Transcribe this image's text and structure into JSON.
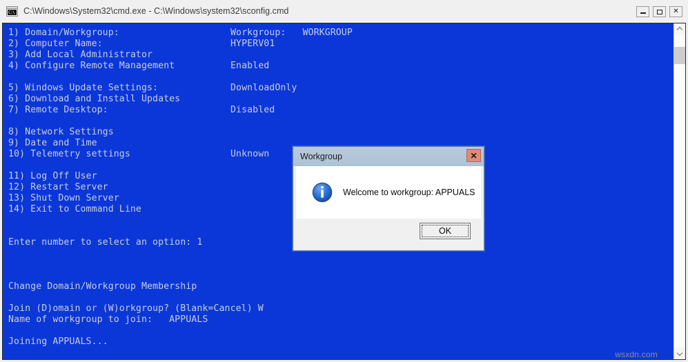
{
  "window": {
    "title": "C:\\Windows\\System32\\cmd.exe - C:\\Windows\\system32\\sconfig.cmd",
    "icon_text": "C:\\",
    "controls": {
      "minimize_label": "–",
      "maximize_label": "□",
      "close_label": "✕"
    }
  },
  "console": {
    "background_color": "#0b37d9",
    "text_color": "#c8cdd8",
    "lines": [
      {
        "label": "1) Domain/Workgroup:",
        "value": "Workgroup:   WORKGROUP"
      },
      {
        "label": "2) Computer Name:",
        "value": "HYPERV01"
      },
      {
        "label": "3) Add Local Administrator",
        "value": ""
      },
      {
        "label": "4) Configure Remote Management",
        "value": "Enabled"
      },
      {
        "label": "",
        "value": ""
      },
      {
        "label": "5) Windows Update Settings:",
        "value": "DownloadOnly"
      },
      {
        "label": "6) Download and Install Updates",
        "value": ""
      },
      {
        "label": "7) Remote Desktop:",
        "value": "Disabled"
      },
      {
        "label": "",
        "value": ""
      },
      {
        "label": "8) Network Settings",
        "value": ""
      },
      {
        "label": "9) Date and Time",
        "value": ""
      },
      {
        "label": "10) Telemetry settings",
        "value": "Unknown"
      },
      {
        "label": "",
        "value": ""
      },
      {
        "label": "11) Log Off User",
        "value": ""
      },
      {
        "label": "12) Restart Server",
        "value": ""
      },
      {
        "label": "13) Shut Down Server",
        "value": ""
      },
      {
        "label": "14) Exit to Command Line",
        "value": ""
      },
      {
        "label": "",
        "value": ""
      },
      {
        "label": "",
        "value": ""
      },
      {
        "label": "Enter number to select an option: 1",
        "value": ""
      },
      {
        "label": "",
        "value": ""
      },
      {
        "label": "",
        "value": ""
      },
      {
        "label": "",
        "value": ""
      },
      {
        "label": "Change Domain/Workgroup Membership",
        "value": ""
      },
      {
        "label": "",
        "value": ""
      },
      {
        "label": "Join (D)omain or (W)orkgroup? (Blank=Cancel) W",
        "value": ""
      },
      {
        "label": "Name of workgroup to join:   APPUALS",
        "value": ""
      },
      {
        "label": "",
        "value": ""
      },
      {
        "label": "Joining APPUALS...",
        "value": ""
      }
    ]
  },
  "dialog": {
    "title": "Workgroup",
    "message": "Welcome to workgroup: APPUALS",
    "close_label": "✕",
    "ok_label": "OK",
    "icon": "info-icon"
  },
  "watermark": {
    "text": "wsxdn.com"
  }
}
